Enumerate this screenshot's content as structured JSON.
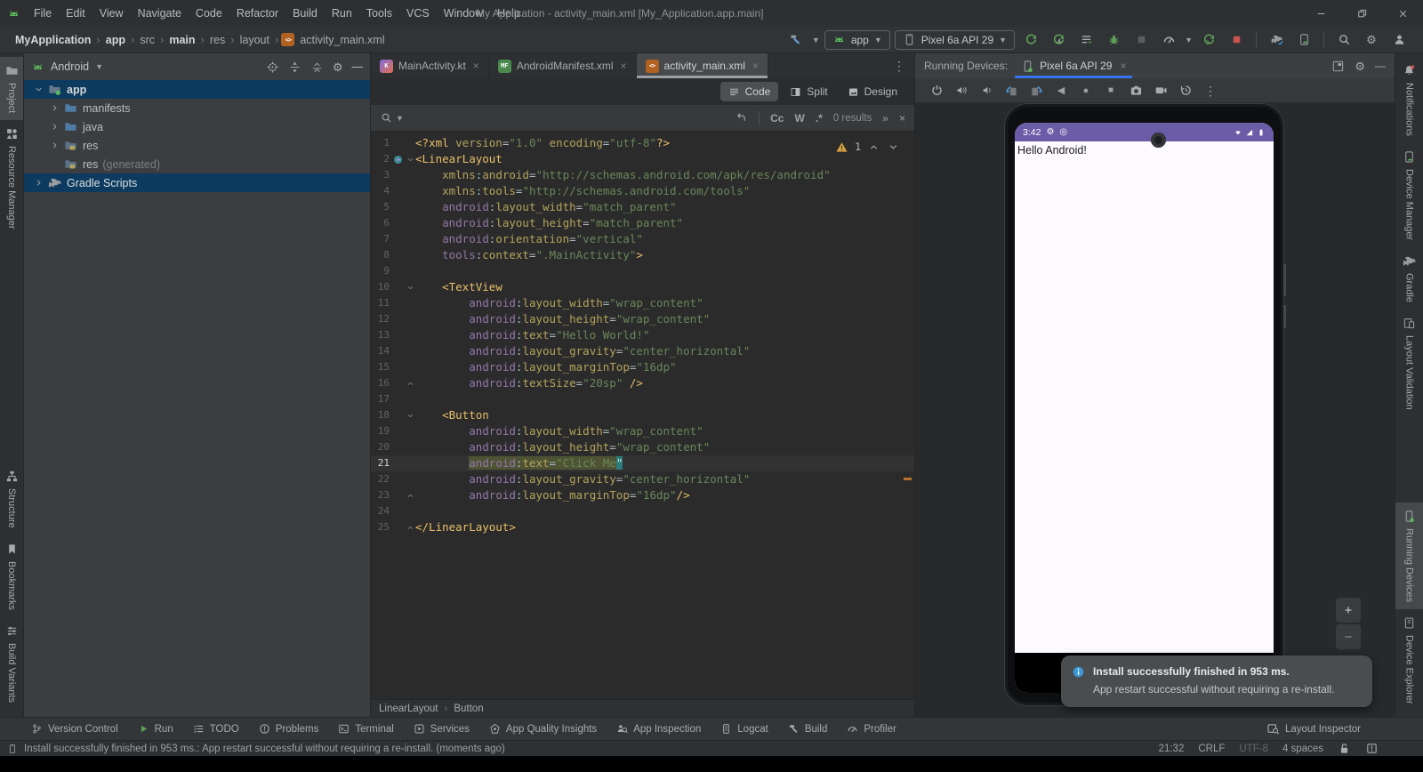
{
  "window": {
    "title": "My Application - activity_main.xml [My_Application.app.main]",
    "menus": [
      "File",
      "Edit",
      "View",
      "Navigate",
      "Code",
      "Refactor",
      "Build",
      "Run",
      "Tools",
      "VCS",
      "Window",
      "Help"
    ]
  },
  "toolbar": {
    "breadcrumbs": [
      {
        "label": "MyApplication",
        "bold": true
      },
      {
        "label": "app",
        "bold": true
      },
      {
        "label": "src",
        "bold": false
      },
      {
        "label": "main",
        "bold": true
      },
      {
        "label": "res",
        "bold": false
      },
      {
        "label": "layout",
        "bold": false
      },
      {
        "label": "activity_main.xml",
        "bold": false,
        "ficon": "xml"
      }
    ],
    "run_config": "app",
    "device": "Pixel 6a API 29"
  },
  "left_stripe": {
    "top": [
      {
        "label": "Project",
        "icon": "project",
        "active": true
      },
      {
        "label": "Resource Manager",
        "icon": "resource-manager",
        "active": false
      }
    ],
    "bottom": [
      {
        "label": "Structure",
        "icon": "structure",
        "active": false
      },
      {
        "label": "Bookmarks",
        "icon": "bookmarks",
        "active": false
      },
      {
        "label": "Build Variants",
        "icon": "build-variants",
        "active": false
      }
    ]
  },
  "right_stripe": {
    "top": [
      {
        "label": "Notifications",
        "icon": "bell",
        "active": false
      },
      {
        "label": "Device Manager",
        "icon": "device-manager",
        "active": false
      },
      {
        "label": "Gradle",
        "icon": "gradle",
        "active": false
      },
      {
        "label": "Layout Validation",
        "icon": "layout-validation",
        "active": false
      }
    ],
    "bottom": [
      {
        "label": "Running Devices",
        "icon": "phone-green",
        "active": true
      },
      {
        "label": "Device Explorer",
        "icon": "device-explorer",
        "active": false
      }
    ]
  },
  "project_panel": {
    "view": "Android",
    "tree": [
      {
        "label": "app",
        "icon": "folder-app",
        "chev": "down",
        "bold": true,
        "selected": true,
        "indent": 0
      },
      {
        "label": "manifests",
        "icon": "folder",
        "chev": "right",
        "indent": 1
      },
      {
        "label": "java",
        "icon": "folder",
        "chev": "right",
        "indent": 1
      },
      {
        "label": "res",
        "icon": "folder-res",
        "chev": "right",
        "indent": 1
      },
      {
        "label": "res",
        "suffix": "(generated)",
        "icon": "folder-res",
        "chev": "none",
        "indent": 1
      },
      {
        "label": "Gradle Scripts",
        "icon": "gradle",
        "chev": "right",
        "selected": true,
        "indent": 0
      }
    ]
  },
  "editor": {
    "tabs": [
      {
        "label": "MainActivity.kt",
        "ficon": "kt",
        "active": false
      },
      {
        "label": "AndroidManifest.xml",
        "ficon": "mf",
        "active": false
      },
      {
        "label": "activity_main.xml",
        "ficon": "xml",
        "active": true
      }
    ],
    "modes": [
      {
        "label": "Code",
        "icon": "code-lines",
        "active": true
      },
      {
        "label": "Split",
        "icon": "split",
        "active": false
      },
      {
        "label": "Design",
        "icon": "design",
        "active": false
      }
    ],
    "find": {
      "toggles": [
        "Cc",
        "W",
        ".*"
      ],
      "results": "0 results",
      "expand": "»",
      "close": "×"
    },
    "warnings": "1",
    "breadcrumb": [
      "LinearLayout",
      "Button"
    ],
    "code": {
      "lines": [
        {
          "n": 1,
          "tokens": [
            [
              "tag",
              "<?xml "
            ],
            [
              "attr",
              "version"
            ],
            [
              "pn",
              "="
            ],
            [
              "val",
              "\"1.0\""
            ],
            [
              "pl",
              " "
            ],
            [
              "attr",
              "encoding"
            ],
            [
              "pn",
              "="
            ],
            [
              "val",
              "\"utf-8\""
            ],
            [
              "tag",
              "?>"
            ]
          ]
        },
        {
          "n": 2,
          "rel": true,
          "fold": "open",
          "tokens": [
            [
              "tag",
              "<LinearLayout"
            ]
          ]
        },
        {
          "n": 3,
          "tokens": [
            [
              "pl",
              "    "
            ],
            [
              "attr",
              "xmlns"
            ],
            [
              "pn",
              ":"
            ],
            [
              "attr",
              "android"
            ],
            [
              "pn",
              "="
            ],
            [
              "val",
              "\"http://schemas.android.com/apk/res/android\""
            ]
          ]
        },
        {
          "n": 4,
          "tokens": [
            [
              "pl",
              "    "
            ],
            [
              "attr",
              "xmlns"
            ],
            [
              "pn",
              ":"
            ],
            [
              "attr",
              "tools"
            ],
            [
              "pn",
              "="
            ],
            [
              "val",
              "\"http://schemas.android.com/tools\""
            ]
          ]
        },
        {
          "n": 5,
          "tokens": [
            [
              "pl",
              "    "
            ],
            [
              "ns",
              "android"
            ],
            [
              "pn",
              ":"
            ],
            [
              "attr",
              "layout_width"
            ],
            [
              "pn",
              "="
            ],
            [
              "val",
              "\"match_parent\""
            ]
          ]
        },
        {
          "n": 6,
          "tokens": [
            [
              "pl",
              "    "
            ],
            [
              "ns",
              "android"
            ],
            [
              "pn",
              ":"
            ],
            [
              "attr",
              "layout_height"
            ],
            [
              "pn",
              "="
            ],
            [
              "val",
              "\"match_parent\""
            ]
          ]
        },
        {
          "n": 7,
          "tokens": [
            [
              "pl",
              "    "
            ],
            [
              "ns",
              "android"
            ],
            [
              "pn",
              ":"
            ],
            [
              "attr",
              "orientation"
            ],
            [
              "pn",
              "="
            ],
            [
              "val",
              "\"vertical\""
            ]
          ]
        },
        {
          "n": 8,
          "tokens": [
            [
              "pl",
              "    "
            ],
            [
              "ns",
              "tools"
            ],
            [
              "pn",
              ":"
            ],
            [
              "attr",
              "context"
            ],
            [
              "pn",
              "="
            ],
            [
              "val",
              "\".MainActivity\""
            ],
            [
              "tag",
              ">"
            ]
          ]
        },
        {
          "n": 9,
          "tokens": []
        },
        {
          "n": 10,
          "fold": "open",
          "tokens": [
            [
              "pl",
              "    "
            ],
            [
              "tag",
              "<TextView"
            ]
          ]
        },
        {
          "n": 11,
          "tokens": [
            [
              "pl",
              "        "
            ],
            [
              "ns",
              "android"
            ],
            [
              "pn",
              ":"
            ],
            [
              "attr",
              "layout_width"
            ],
            [
              "pn",
              "="
            ],
            [
              "val",
              "\"wrap_content\""
            ]
          ]
        },
        {
          "n": 12,
          "tokens": [
            [
              "pl",
              "        "
            ],
            [
              "ns",
              "android"
            ],
            [
              "pn",
              ":"
            ],
            [
              "attr",
              "layout_height"
            ],
            [
              "pn",
              "="
            ],
            [
              "val",
              "\"wrap_content\""
            ]
          ]
        },
        {
          "n": 13,
          "tokens": [
            [
              "pl",
              "        "
            ],
            [
              "ns",
              "android"
            ],
            [
              "pn",
              ":"
            ],
            [
              "attr",
              "text"
            ],
            [
              "pn",
              "="
            ],
            [
              "val",
              "\"Hello World!\""
            ]
          ]
        },
        {
          "n": 14,
          "tokens": [
            [
              "pl",
              "        "
            ],
            [
              "ns",
              "android"
            ],
            [
              "pn",
              ":"
            ],
            [
              "attr",
              "layout_gravity"
            ],
            [
              "pn",
              "="
            ],
            [
              "val",
              "\"center_horizontal\""
            ]
          ]
        },
        {
          "n": 15,
          "tokens": [
            [
              "pl",
              "        "
            ],
            [
              "ns",
              "android"
            ],
            [
              "pn",
              ":"
            ],
            [
              "attr",
              "layout_marginTop"
            ],
            [
              "pn",
              "="
            ],
            [
              "val",
              "\"16dp\""
            ]
          ]
        },
        {
          "n": 16,
          "fold": "close",
          "tokens": [
            [
              "pl",
              "        "
            ],
            [
              "ns",
              "android"
            ],
            [
              "pn",
              ":"
            ],
            [
              "attr",
              "textSize"
            ],
            [
              "pn",
              "="
            ],
            [
              "val",
              "\"20sp\""
            ],
            [
              "pl",
              " "
            ],
            [
              "tag",
              "/>"
            ]
          ]
        },
        {
          "n": 17,
          "tokens": []
        },
        {
          "n": 18,
          "fold": "open",
          "tokens": [
            [
              "pl",
              "    "
            ],
            [
              "tag",
              "<Button"
            ]
          ]
        },
        {
          "n": 19,
          "tokens": [
            [
              "pl",
              "        "
            ],
            [
              "ns",
              "android"
            ],
            [
              "pn",
              ":"
            ],
            [
              "attr",
              "layout_width"
            ],
            [
              "pn",
              "="
            ],
            [
              "val",
              "\"wrap_content\""
            ]
          ]
        },
        {
          "n": 20,
          "tokens": [
            [
              "pl",
              "        "
            ],
            [
              "ns",
              "android"
            ],
            [
              "pn",
              ":"
            ],
            [
              "attr",
              "layout_height"
            ],
            [
              "pn",
              "="
            ],
            [
              "val",
              "\"wrap_content\""
            ]
          ]
        },
        {
          "n": 21,
          "caret": true,
          "tokens": [
            [
              "pl",
              "        "
            ],
            [
              "ns hl",
              "android"
            ],
            [
              "pn hl",
              ":"
            ],
            [
              "attr hl",
              "text"
            ],
            [
              "pn hl",
              "="
            ],
            [
              "val hl",
              "\"Click Me"
            ],
            [
              "val sel",
              "\""
            ]
          ]
        },
        {
          "n": 22,
          "tokens": [
            [
              "pl",
              "        "
            ],
            [
              "ns",
              "android"
            ],
            [
              "pn",
              ":"
            ],
            [
              "attr",
              "layout_gravity"
            ],
            [
              "pn",
              "="
            ],
            [
              "val",
              "\"center_horizontal\""
            ]
          ]
        },
        {
          "n": 23,
          "fold": "close",
          "tokens": [
            [
              "pl",
              "        "
            ],
            [
              "ns",
              "android"
            ],
            [
              "pn",
              ":"
            ],
            [
              "attr",
              "layout_marginTop"
            ],
            [
              "pn",
              "="
            ],
            [
              "val",
              "\"16dp\""
            ],
            [
              "tag",
              "/>"
            ]
          ]
        },
        {
          "n": 24,
          "tokens": []
        },
        {
          "n": 25,
          "fold": "close",
          "tokens": [
            [
              "tag",
              "</LinearLayout>"
            ]
          ]
        }
      ]
    }
  },
  "device_panel": {
    "label": "Running Devices:",
    "tab": "Pixel 6a API 29",
    "screen": {
      "time": "3:42",
      "app_text": "Hello Android!"
    },
    "zoom_in": "+",
    "zoom_out": "−"
  },
  "notification": {
    "title": "Install successfully finished in 953 ms.",
    "body": "App restart successful without requiring a re-install."
  },
  "tool_windows": {
    "left": [
      {
        "label": "Version Control",
        "icon": "branch"
      },
      {
        "label": "Run",
        "icon": "play"
      },
      {
        "label": "TODO",
        "icon": "todo"
      },
      {
        "label": "Problems",
        "icon": "problems"
      },
      {
        "label": "Terminal",
        "icon": "terminal"
      },
      {
        "label": "Services",
        "icon": "services"
      },
      {
        "label": "App Quality Insights",
        "icon": "quality"
      },
      {
        "label": "App Inspection",
        "icon": "inspection"
      },
      {
        "label": "Logcat",
        "icon": "logcat"
      },
      {
        "label": "Build",
        "icon": "hammer"
      },
      {
        "label": "Profiler",
        "icon": "gauge"
      }
    ],
    "right": {
      "label": "Layout Inspector",
      "icon": "layout-inspector"
    }
  },
  "status_bar": {
    "message": "Install successfully finished in 953 ms.: App restart successful without requiring a re-install. (moments ago)",
    "caret": "21:32",
    "line_ending": "CRLF",
    "encoding": "UTF-8",
    "indent": "4 spaces"
  }
}
